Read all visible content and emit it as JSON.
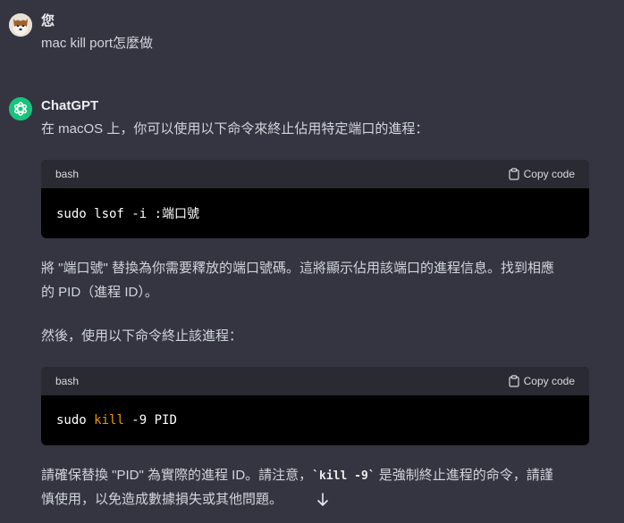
{
  "user_message": {
    "author": "您",
    "text": "mac kill port怎麼做"
  },
  "assistant_message": {
    "author": "ChatGPT",
    "intro": "在 macOS 上，你可以使用以下命令來終止佔用特定端口的進程：",
    "code1": {
      "language": "bash",
      "copy_label": "Copy code",
      "line": "sudo lsof -i :端口號"
    },
    "para2_line1": "將 \"端口號\" 替換為你需要釋放的端口號碼。這將顯示佔用該端口的進程信息。找到相應",
    "para2_line2": "的 PID（進程 ID）。",
    "para3": "然後，使用以下命令終止該進程：",
    "code2": {
      "language": "bash",
      "copy_label": "Copy code",
      "part1": "sudo ",
      "keyword": "kill",
      "part2": " -9 PID"
    },
    "para4_line1_a": "請確保替換 \"PID\" 為實際的進程 ID。請注意，",
    "para4_inline_code": "`kill -9`",
    "para4_line1_b": " 是強制終止進程的命令，請謹",
    "para4_line2": "慎使用，以免造成數據損失或其他問題。"
  },
  "colors": {
    "background": "#343541",
    "chatgpt_logo": "#19c37d",
    "code_keyword": "#e9950c"
  },
  "icons": {
    "user_avatar": "dog-avatar",
    "assistant_avatar": "openai-logo-icon",
    "copy": "clipboard-icon",
    "scroll": "arrow-down-icon"
  }
}
